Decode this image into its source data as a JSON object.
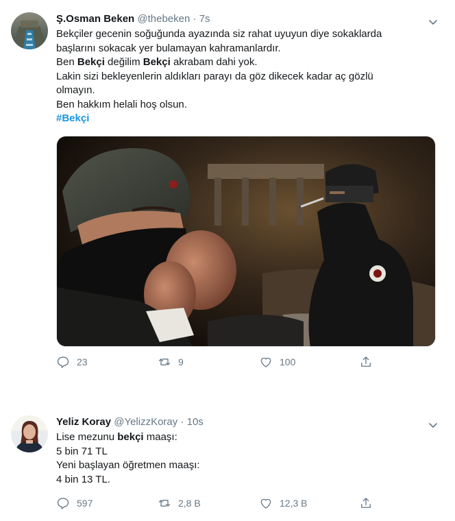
{
  "tweets": [
    {
      "author_name": "Ş.Osman Beken",
      "handle": "@thebeken",
      "separator": "·",
      "time": "7s",
      "lines": [
        {
          "segments": [
            {
              "t": "Bekçiler gecenin soğuğunda ayazında siz rahat uyuyun diye sokaklarda"
            }
          ]
        },
        {
          "segments": [
            {
              "t": "başlarını sokacak yer bulamayan kahramanlardır."
            }
          ]
        },
        {
          "segments": [
            {
              "t": "Ben "
            },
            {
              "t": "Bekçi",
              "b": true
            },
            {
              "t": " değilim "
            },
            {
              "t": "Bekçi",
              "b": true
            },
            {
              "t": " akrabam dahi yok."
            }
          ]
        },
        {
          "segments": [
            {
              "t": "Lakin sizi bekleyenlerin aldıkları parayı da göz dikecek kadar aç gözlü"
            }
          ]
        },
        {
          "segments": [
            {
              "t": "olmayın."
            }
          ]
        },
        {
          "segments": [
            {
              "t": "Ben hakkım helali hoş olsun."
            }
          ]
        }
      ],
      "hashtag": "#Bekçi",
      "reply_count": "23",
      "retweet_count": "9",
      "like_count": "100",
      "share_label": ""
    },
    {
      "author_name": "Yeliz Koray",
      "handle": "@YelizzKoray",
      "separator": "·",
      "time": "10s",
      "lines": [
        {
          "segments": [
            {
              "t": "Lise mezunu "
            },
            {
              "t": "bekçi",
              "b": true
            },
            {
              "t": " maaşı:"
            }
          ]
        },
        {
          "segments": [
            {
              "t": "5 bin 71 TL"
            }
          ]
        },
        {
          "segments": [
            {
              "t": "Yeni başlayan öğretmen maaşı:"
            }
          ]
        },
        {
          "segments": [
            {
              "t": "4 bin 13 TL."
            }
          ]
        }
      ],
      "reply_count": "597",
      "retweet_count": "2,8 B",
      "like_count": "12,3 B",
      "share_label": ""
    }
  ],
  "icons": {
    "reply": "reply-icon",
    "retweet": "retweet-icon",
    "like": "heart-icon",
    "share": "share-icon",
    "menu": "chevron-down-icon"
  },
  "colors": {
    "text": "#14171a",
    "secondary": "#657786",
    "link": "#1b95e0"
  }
}
